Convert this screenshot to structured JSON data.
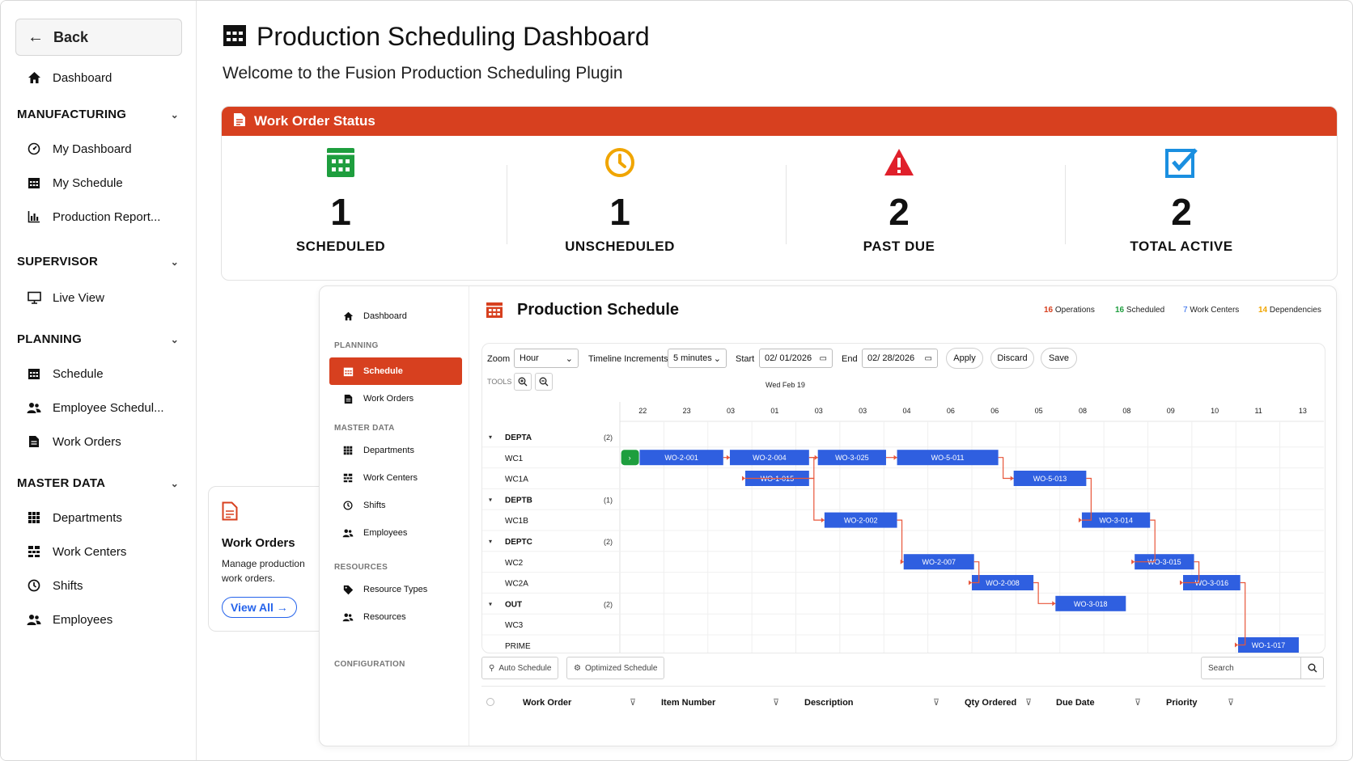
{
  "sidebar": {
    "back_label": "Back",
    "dashboard_label": "Dashboard",
    "sections": [
      {
        "title": "MANUFACTURING",
        "items": [
          "My Dashboard",
          "My Schedule",
          "Production Report..."
        ]
      },
      {
        "title": "SUPERVISOR",
        "items": [
          "Live View"
        ]
      },
      {
        "title": "PLANNING",
        "items": [
          "Schedule",
          "Employee Schedul...",
          "Work Orders"
        ]
      },
      {
        "title": "MASTER DATA",
        "items": [
          "Departments",
          "Work Centers",
          "Shifts",
          "Employees"
        ]
      }
    ]
  },
  "header": {
    "title": "Production Scheduling Dashboard",
    "subtitle": "Welcome to the Fusion Production Scheduling Plugin"
  },
  "status": {
    "title": "Work Order Status",
    "stats": [
      {
        "value": "1",
        "label": "SCHEDULED",
        "color": "#1e9e3e",
        "icon": "calendar-icon"
      },
      {
        "value": "1",
        "label": "UNSCHEDULED",
        "color": "#f0a500",
        "icon": "clock-icon"
      },
      {
        "value": "2",
        "label": "PAST DUE",
        "color": "#e0202b",
        "icon": "warning-icon"
      },
      {
        "value": "2",
        "label": "TOTAL ACTIVE",
        "color": "#1a8fe0",
        "icon": "checkbox-icon"
      }
    ]
  },
  "wo_card": {
    "title": "Work Orders",
    "description": "Manage production work orders.",
    "link_label": "View All →"
  },
  "inner_sidebar": {
    "dashboard": "Dashboard",
    "planning_section": "PLANNING",
    "schedule": "Schedule",
    "work_orders": "Work Orders",
    "master_section": "MASTER DATA",
    "departments": "Departments",
    "work_centers": "Work Centers",
    "shifts": "Shifts",
    "employees": "Employees",
    "resources_section": "RESOURCES",
    "resource_types": "Resource Types",
    "resources": "Resources",
    "config_section": "CONFIGURATION"
  },
  "schedule": {
    "title": "Production Schedule",
    "legend": [
      {
        "count": "16",
        "label": "Operations",
        "color": "#d7401f"
      },
      {
        "count": "16",
        "label": "Scheduled",
        "color": "#1e9e3e"
      },
      {
        "count": "7",
        "label": "Work Centers",
        "color": "#2563eb"
      },
      {
        "count": "14",
        "label": "Dependencies",
        "color": "#f0a500"
      }
    ],
    "zoom_label": "Zoom",
    "zoom_value": "Hour",
    "increments_label": "Timeline Increments",
    "increments_value": "5 minutes",
    "start_label": "Start",
    "start_value": "02/ 01/2026",
    "end_label": "End",
    "end_value": "02/ 28/2026",
    "apply": "Apply",
    "discard": "Discard",
    "save": "Save",
    "tools_label": "TOOLS",
    "date_header": "Wed Feb 19",
    "hours": [
      "22",
      "23",
      "03",
      "01",
      "03",
      "03",
      "04",
      "06",
      "06",
      "05",
      "08",
      "08",
      "09",
      "10",
      "11",
      "13"
    ],
    "rows": [
      {
        "name": "DEPTA",
        "group": true,
        "count": "(2)"
      },
      {
        "name": "WC1",
        "group": false,
        "count": ""
      },
      {
        "name": "WC1A",
        "group": false,
        "count": ""
      },
      {
        "name": "DEPTB",
        "group": true,
        "count": "(1)"
      },
      {
        "name": "WC1B",
        "group": false,
        "count": ""
      },
      {
        "name": "DEPTC",
        "group": true,
        "count": "(2)"
      },
      {
        "name": "WC2",
        "group": false,
        "count": ""
      },
      {
        "name": "WC2A",
        "group": false,
        "count": ""
      },
      {
        "name": "OUT",
        "group": true,
        "count": "(2)"
      },
      {
        "name": "WC3",
        "group": false,
        "count": ""
      },
      {
        "name": "PRIME",
        "group": false,
        "count": ""
      }
    ],
    "bars": [
      "WO-2-001",
      "WO-2-004",
      "WO-3-025",
      "WO-5-011",
      "WO-1-015",
      "WO-5-013",
      "WO-2-002",
      "WO-3-014",
      "WO-2-007",
      "WO-3-015",
      "WO-2-008",
      "WO-3-016",
      "WO-3-018",
      "WO-1-017"
    ],
    "auto_schedule": "Auto Schedule",
    "optimized_schedule": "Optimized Schedule",
    "search_placeholder": "Search",
    "columns": [
      "Work Order",
      "Item Number",
      "Description",
      "Qty Ordered",
      "Due Date",
      "Priority"
    ]
  }
}
